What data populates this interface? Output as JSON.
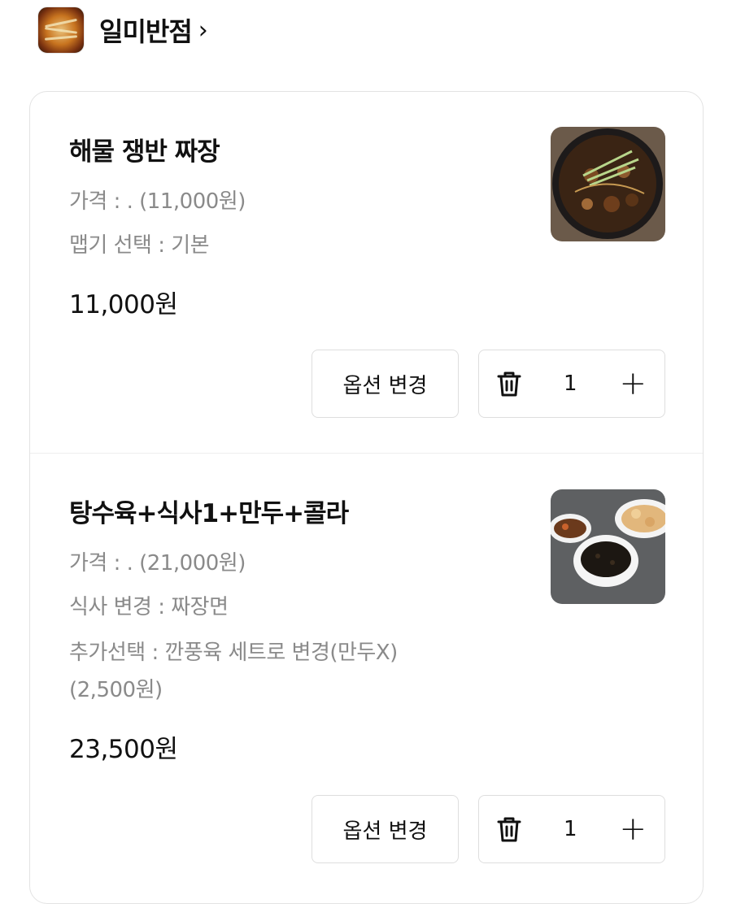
{
  "store": {
    "name": "일미반점",
    "chevron": "›"
  },
  "items": [
    {
      "name": "해물 쟁반 짜장",
      "options": [
        "가격 : . (11,000원)",
        "맵기 선택 : 기본"
      ],
      "price": "11,000원",
      "option_button": "옵션 변경",
      "quantity": "1",
      "plus": "+"
    },
    {
      "name": "탕수육+식사1+만두+콜라",
      "options": [
        "가격 : . (21,000원)",
        "식사 변경 : 짜장면",
        "추가선택 : 깐풍육 세트로 변경(만두X)",
        "(2,500원)"
      ],
      "price": "23,500원",
      "option_button": "옵션 변경",
      "quantity": "1",
      "plus": "+"
    }
  ],
  "colors": {
    "text_primary": "#111111",
    "text_secondary": "#8a8a8a",
    "border": "#dedede"
  }
}
